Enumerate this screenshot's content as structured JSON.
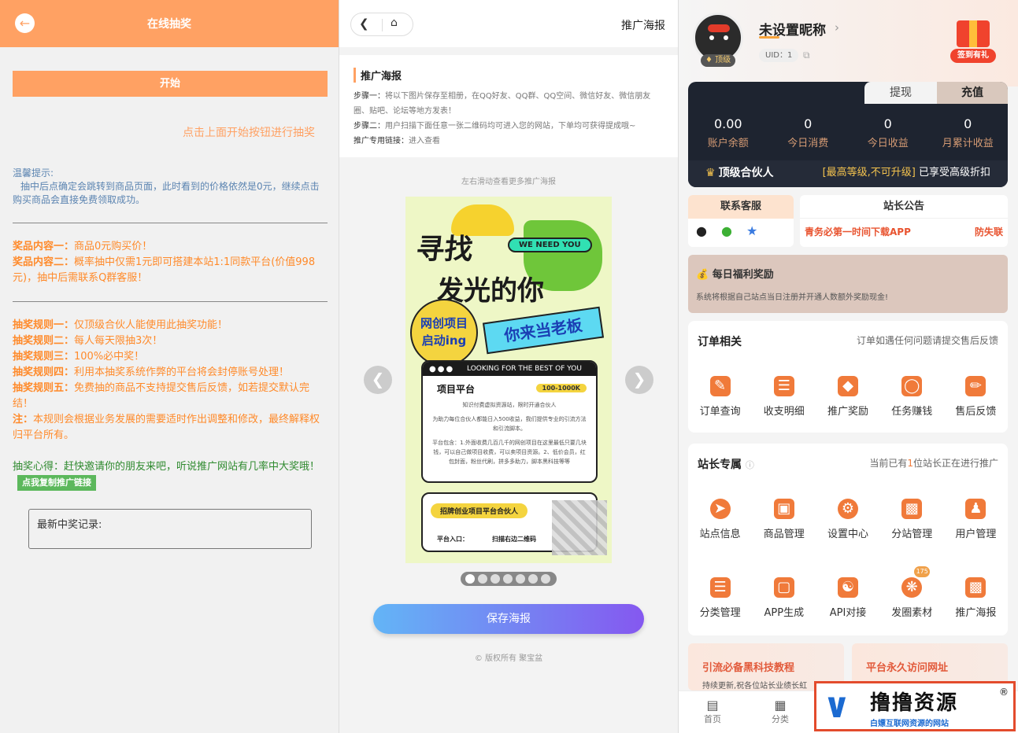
{
  "lottery": {
    "title": "在线抽奖",
    "start_label": "开始",
    "hint": "点击上面开始按钮进行抽奖",
    "tip_title": "温馨提示:",
    "tip_text": "抽中后点确定会跳转到商品页面，此时看到的价格依然是0元，继续点击购买商品会直接免费领取成功。",
    "prizes": [
      {
        "label": "奖品内容一：",
        "text": "商品0元购买价！"
      },
      {
        "label": "奖品内容二：",
        "text": "概率抽中仅需1元即可搭建本站1:1同款平台(价值998元)，抽中后需联系Q群客服！"
      }
    ],
    "rules": [
      {
        "label": "抽奖规则一：",
        "text": "仅顶级合伙人能使用此抽奖功能！"
      },
      {
        "label": "抽奖规则二：",
        "text": "每人每天限抽3次！"
      },
      {
        "label": "抽奖规则三：",
        "text": "100%必中奖！"
      },
      {
        "label": "抽奖规则四：",
        "text": "利用本抽奖系统作弊的平台将会封停账号处理！"
      },
      {
        "label": "抽奖规则五：",
        "text": "免费抽的商品不支持提交售后反馈，如若提交默认完结！"
      },
      {
        "label": "注：",
        "text": "本规则会根据业务发展的需要适时作出调整和修改，最终解释权归平台所有。"
      }
    ],
    "exp_label": "抽奖心得：",
    "exp_text": "赶快邀请你的朋友来吧，听说推广网站有几率中大奖哦！",
    "copy_link_label": "点我复制推广链接",
    "record_label": "最新中奖记录:"
  },
  "poster_page": {
    "title": "推广海报",
    "section_title": "推广海报",
    "step1_label": "步骤一：",
    "step1_text": "将以下图片保存至相册，在QQ好友、QQ群、QQ空间、微信好友、微信朋友圈、贴吧、论坛等地方发表！",
    "step2_label": "步骤二：",
    "step2_text": "用户扫描下面任意一张二维码均可进入您的网站，下单均可获得提成哦~",
    "link_label": "推广专用链接：",
    "link_text": "进入查看",
    "scroll_hint": "左右滑动查看更多推广海报",
    "save_label": "保存海报",
    "copyright": "© 版权所有 聚宝盆",
    "slides": 7,
    "active_slide": 1,
    "poster": {
      "headline1": "寻找",
      "headline2": "发光的你",
      "we_need": "WE NEED YOU",
      "circle_text1": "网创项目",
      "circle_text2": "启动ing",
      "band_text": "你来当老板",
      "card_head": "LOOKING FOR THE BEST OF YOU",
      "card_title": "项目平台",
      "card_badge": "100-1000K",
      "card_p1": "知识付费虚拟资源站，限时开通合伙人",
      "card_p2": "为助力每位合伙人都能日入500收益，我们提供专业的引流方法和引流脚本。",
      "card_p3": "平台包含：1.外面收费几百几千的网创项目在这里最低只要几块钱，可以自己做项目收费，可以卖项目资源。2、低价会员，红包封面，粉丝代刷，拼多多助力，脚本黑科技等等",
      "card2_pill": "招牌创业项目平台合伙人",
      "card2_in": "平台入口：",
      "card2_scan": "扫描右边二维码"
    }
  },
  "user_center": {
    "nickname": "未设置昵称",
    "vip_tag": "顶级",
    "uid": "UID：1",
    "gift_label": "签到有礼",
    "tab_withdraw": "提现",
    "tab_recharge": "充值",
    "stats": [
      {
        "value": "0.00",
        "label": "账户余额"
      },
      {
        "value": "0",
        "label": "今日消费"
      },
      {
        "value": "0",
        "label": "今日收益"
      },
      {
        "value": "0",
        "label": "月累计收益"
      }
    ],
    "level": "顶级合伙人",
    "level_note": "[最高等级,不可升级]",
    "level_note2": " 已享受高级折扣",
    "service_title": "联系客服",
    "notice_title": "站长公告",
    "notice_text": "青务必第一时间下载APP",
    "notice_tag": "防失联",
    "welfare_title": "每日福利奖励",
    "welfare_text": "系统将根据自己站点当日注册并开通人数额外奖励现金!",
    "orders_title": "订单相关",
    "orders_note": "订单如遇任何问题请提交售后反馈",
    "orders_items": [
      "订单查询",
      "收支明细",
      "推广奖励",
      "任务赚钱",
      "售后反馈"
    ],
    "admin_title": "站长专属",
    "admin_note_pre": "当前已有",
    "admin_note_num": "1",
    "admin_note_post": "位站长正在进行推广",
    "admin_items_row1": [
      "站点信息",
      "商品管理",
      "设置中心",
      "分站管理",
      "用户管理"
    ],
    "admin_items_row2": [
      "分类管理",
      "APP生成",
      "API对接",
      "发圈素材",
      "推广海报"
    ],
    "material_badge": "175",
    "promo1_title": "引流必备黑科技教程",
    "promo1_text": "持续更新,祝各位站长业绩长虹",
    "promo2_title": "平台永久访问网址",
    "tab_home": "首页",
    "tab_category": "分类",
    "watermark_title": "撸撸资源",
    "watermark_sub": "白嫖互联网资源的网站",
    "watermark_reg": "®"
  }
}
